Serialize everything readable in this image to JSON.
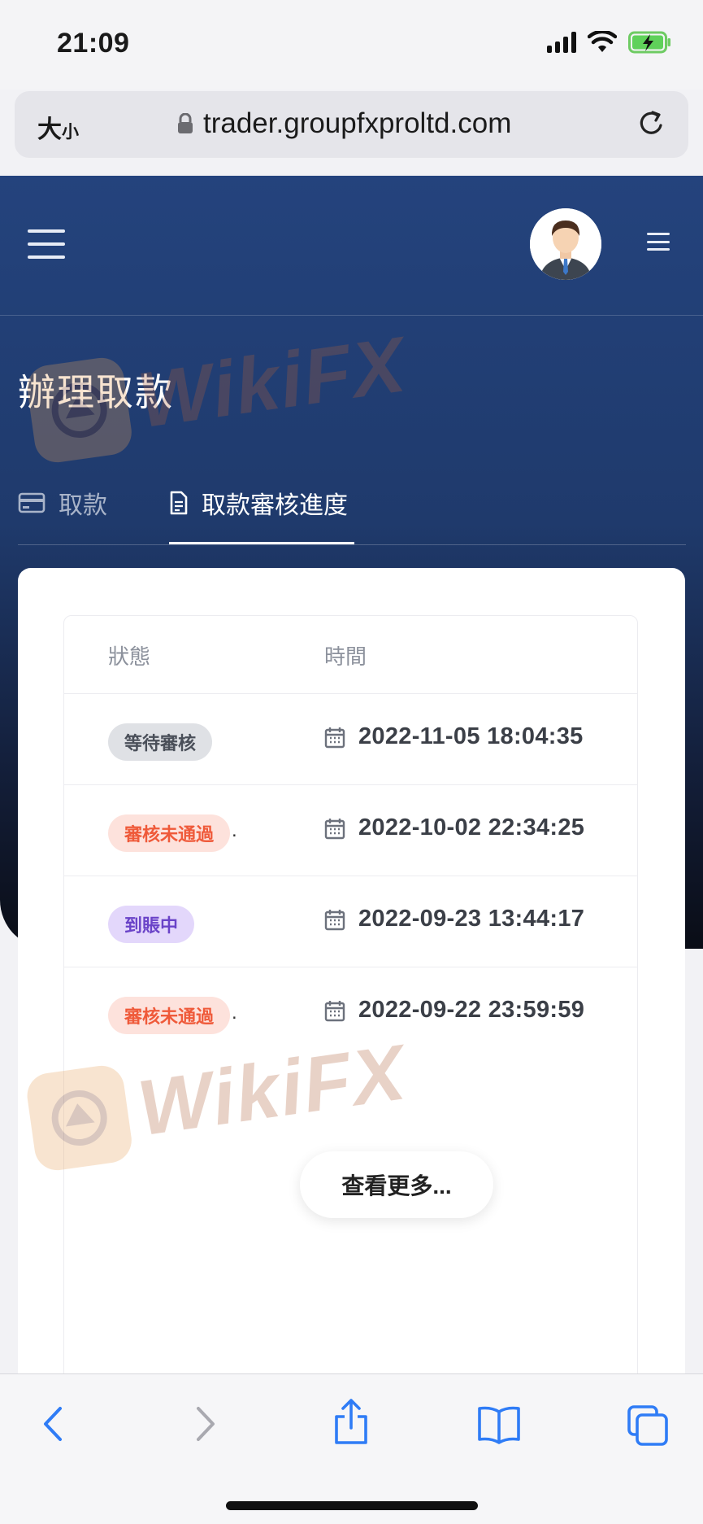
{
  "status": {
    "time": "21:09"
  },
  "browser": {
    "text_size_big": "大",
    "text_size_small": "小",
    "url": "trader.groupfxproltd.com"
  },
  "page": {
    "title": "辦理取款",
    "tabs": [
      {
        "label": "取款",
        "active": false
      },
      {
        "label": "取款審核進度",
        "active": true
      }
    ]
  },
  "watermark": {
    "text": "WikiFX"
  },
  "table": {
    "headers": {
      "status": "狀態",
      "time": "時間"
    },
    "rows": [
      {
        "status": "等待審核",
        "status_type": "pending",
        "time": "2022-11-05 18:04:35"
      },
      {
        "status": "審核未通過",
        "status_type": "rejected",
        "time": "2022-10-02 22:34:25"
      },
      {
        "status": "到賬中",
        "status_type": "arriving",
        "time": "2022-09-23 13:44:17"
      },
      {
        "status": "審核未通過",
        "status_type": "rejected",
        "time": "2022-09-22 23:59:59"
      }
    ],
    "more_label": "查看更多..."
  },
  "colors": {
    "header_top": "#24437d",
    "header_bottom": "#0a0d16",
    "pending": "#dfe1e5",
    "rejected": "#fde2dc",
    "arriving": "#e3d7fb",
    "ios_blue": "#2f7cf6"
  }
}
